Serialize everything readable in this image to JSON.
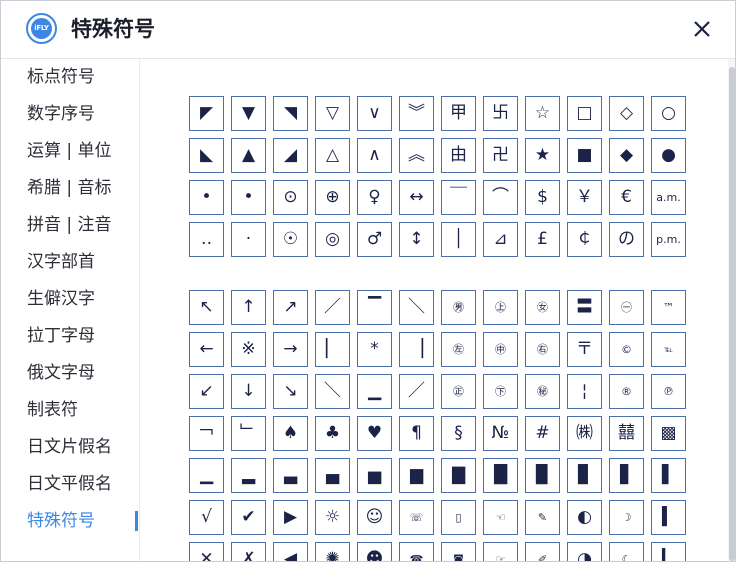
{
  "header": {
    "title": "特殊符号",
    "logo_text": "iFLY"
  },
  "sidebar": {
    "items": [
      {
        "label": "标点符号",
        "active": false
      },
      {
        "label": "数字序号",
        "active": false
      },
      {
        "label": "运算 | 单位",
        "active": false
      },
      {
        "label": "希腊 | 音标",
        "active": false
      },
      {
        "label": "拼音 | 注音",
        "active": false
      },
      {
        "label": "汉字部首",
        "active": false
      },
      {
        "label": "生僻汉字",
        "active": false
      },
      {
        "label": "拉丁字母",
        "active": false
      },
      {
        "label": "俄文字母",
        "active": false
      },
      {
        "label": "制表符",
        "active": false
      },
      {
        "label": "日文片假名",
        "active": false
      },
      {
        "label": "日文平假名",
        "active": false
      },
      {
        "label": "特殊符号",
        "active": true
      }
    ]
  },
  "group1": [
    [
      "◤",
      "▼",
      "◥",
      "▽",
      "∨",
      "︾",
      "甲",
      "卐",
      "☆",
      "□",
      "◇",
      "○"
    ],
    [
      "◣",
      "▲",
      "◢",
      "△",
      "∧",
      "︽",
      "由",
      "卍",
      "★",
      "■",
      "◆",
      "●"
    ],
    [
      "•",
      "•",
      "⊙",
      "⊕",
      "♀",
      "↔",
      "￣",
      "⌒",
      "$",
      "￥",
      "€",
      "a.m."
    ],
    [
      "‥",
      "·",
      "☉",
      "◎",
      "♂",
      "↕",
      "│",
      "⊿",
      "£",
      "￠",
      "の",
      "p.m."
    ]
  ],
  "group2": [
    [
      "↖",
      "↑",
      "↗",
      "／",
      "▔",
      "＼",
      "㊚",
      "㊤",
      "㊛",
      "〓",
      "㊀",
      "™"
    ],
    [
      "←",
      "※",
      "→",
      "▏",
      "*",
      "▕",
      "㊧",
      "㊥",
      "㊨",
      "〒",
      "©",
      "℡"
    ],
    [
      "↙",
      "↓",
      "↘",
      "＼",
      "▁",
      "／",
      "㊣",
      "㊦",
      "㊙",
      "¦",
      "®",
      "℗"
    ],
    [
      "￢",
      "﹂",
      "♠",
      "♣",
      "♥",
      "¶",
      "§",
      "№",
      "#",
      "㈱",
      "囍",
      "▩"
    ],
    [
      "▁",
      "▂",
      "▃",
      "▄",
      "▅",
      "▆",
      "▇",
      "█",
      "▉",
      "▊",
      "▋",
      "▌"
    ],
    [
      "√",
      "✔",
      "▶",
      "☼",
      "☺",
      "☏",
      "▯",
      "☜",
      "✎",
      "◐",
      "☽",
      "▍"
    ],
    [
      "✕",
      "✗",
      "◀",
      "✺",
      "☻",
      "☎",
      "◙",
      "☞",
      "✐",
      "◑",
      "☾",
      "▎"
    ]
  ]
}
